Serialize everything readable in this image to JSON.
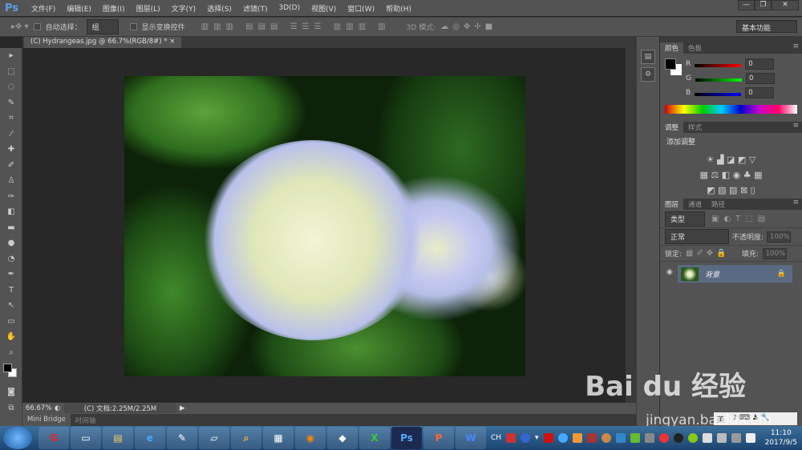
{
  "app": {
    "logo": "Ps",
    "menus": [
      "文件(F)",
      "编辑(E)",
      "图像(I)",
      "图层(L)",
      "文字(Y)",
      "选择(S)",
      "滤镜(T)",
      "3D(D)",
      "视图(V)",
      "窗口(W)",
      "帮助(H)"
    ],
    "window_buttons": [
      "—",
      "❐",
      "✕"
    ]
  },
  "options": {
    "auto_select_label": "自动选择：",
    "auto_select_value": "组",
    "show_transform_label": "显示变换控件",
    "mode_3d_label": "3D 模式:",
    "workspace": "基本功能"
  },
  "document": {
    "tab_title": "(C) Hydrangeas.jpg @ 66.7%(RGB/8#) *",
    "close": "×",
    "zoom": "66.67%",
    "doc_size": "(C) 文档:2.25M/2.25M"
  },
  "bottom_tabs": [
    "Mini Bridge",
    "时间轴"
  ],
  "panels": {
    "color": {
      "tabs": [
        "颜色",
        "色板"
      ],
      "channels": [
        {
          "label": "R",
          "value": "0",
          "color": "#ff0000"
        },
        {
          "label": "G",
          "value": "0",
          "color": "#00ff00"
        },
        {
          "label": "B",
          "value": "0",
          "color": "#0000ff"
        }
      ],
      "foreground": "#000000",
      "background": "#ffffff"
    },
    "adjustments": {
      "tabs": [
        "调整",
        "样式"
      ],
      "title": "添加调整"
    },
    "layers": {
      "tabs": [
        "图层",
        "通道",
        "路径"
      ],
      "filter": "类型",
      "blend_mode": "正常",
      "opacity_label": "不透明度:",
      "opacity": "100%",
      "lock_label": "锁定:",
      "fill_label": "填充:",
      "fill": "100%",
      "layers": [
        {
          "name": "背景",
          "visible": true,
          "locked": true
        }
      ]
    }
  },
  "taskbar": {
    "tray_lang": "CH",
    "time": "11:10",
    "date": "2017/9/5"
  },
  "watermark": {
    "text": "Bai du 经验",
    "url": "jingyan.baidu.com"
  },
  "ime": {
    "label": "英"
  }
}
